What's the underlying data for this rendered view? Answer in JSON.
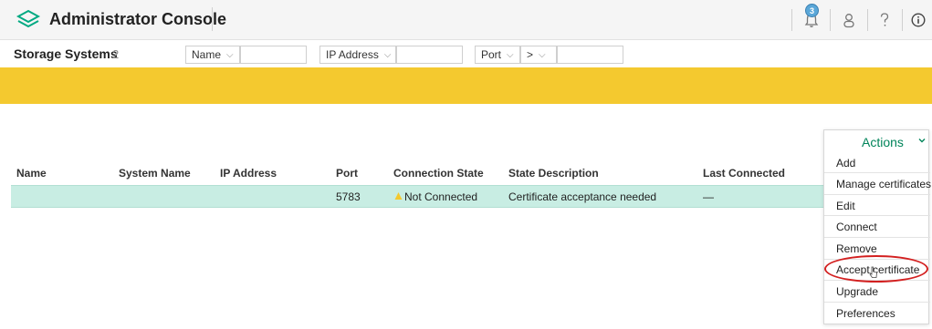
{
  "header": {
    "title": "Administrator Console",
    "notifications_count": "3",
    "icons": [
      "logo-icon",
      "bell-icon",
      "user-icon",
      "help-icon",
      "info-icon"
    ]
  },
  "filterbar": {
    "title": "Storage Systems",
    "count": "2",
    "filters": [
      {
        "label": "Name",
        "value": ""
      },
      {
        "label": "IP Address",
        "value": ""
      },
      {
        "label": "Port",
        "operator": ">",
        "value": ""
      }
    ]
  },
  "colors": {
    "banner": "#f4c92f",
    "row_selected": "#c8ede3",
    "accent": "#01845a",
    "warning": "#f4c92f",
    "highlight": "#d32020"
  },
  "table": {
    "columns": [
      "Name",
      "System Name",
      "IP Address",
      "Port",
      "Connection State",
      "State Description",
      "Last Connected"
    ],
    "rows": [
      {
        "name": "",
        "system_name": "",
        "ip": "",
        "port": "5783",
        "connection_state": "Not Connected",
        "state_description": "Certificate acceptance needed",
        "last_connected": "—"
      }
    ]
  },
  "actions_menu": {
    "title": "Actions",
    "items": [
      "Add",
      "Manage certificates",
      "Edit",
      "Connect",
      "Remove",
      "Accept certificate",
      "Upgrade",
      "Preferences"
    ],
    "highlighted_item": "Accept certificate"
  }
}
